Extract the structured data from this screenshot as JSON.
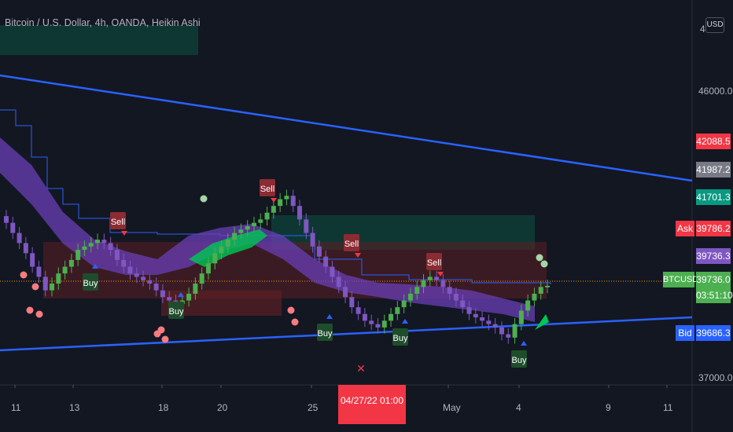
{
  "header": {
    "title": "Bitcoin / U.S. Dollar, 4h, OANDA, Heikin Ashi",
    "currency_button": "USD"
  },
  "price_axis": {
    "ticks": [
      "46000.0",
      "37000.0"
    ],
    "partial_top_tick": "4",
    "labels": {
      "ask_price": "42088.5",
      "last_close": "41987.2",
      "green_level": "41701.3",
      "ask_tag": "Ask",
      "ask_value": "39786.2",
      "purple_level": "39736.3",
      "symbol_tag": "BTCUSD",
      "current_price": "39736.0",
      "countdown": "03:51:10",
      "bid_tag": "Bid",
      "bid_value": "39686.3"
    }
  },
  "time_axis": {
    "ticks": [
      "11",
      "13",
      "18",
      "20",
      "25",
      "May",
      "4",
      "9",
      "11"
    ],
    "highlighted": "04/27/22  01:00"
  },
  "signals": {
    "buy_label": "Buy",
    "sell_label": "Sell",
    "cross_mark": "✕"
  },
  "colors": {
    "background": "#131722",
    "bull_candle": "#4caf50",
    "bear_candle": "#7e57c2",
    "trendline": "#2962ff",
    "sell_box": "#6d1a1f",
    "buy_box": "#1b5e20",
    "ask": "#f23645",
    "bid": "#2962ff",
    "last": "#4caf50"
  },
  "chart_data": {
    "type": "candlestick",
    "title": "Bitcoin / U.S. Dollar, 4h, OANDA, Heikin Ashi",
    "xlabel": "",
    "ylabel": "",
    "ylim": [
      36800,
      48200
    ],
    "x_ticks": [
      "11",
      "13",
      "18",
      "20",
      "25",
      "04/27/22  01:00",
      "May",
      "4",
      "9",
      "11"
    ],
    "y_ticks": [
      46000,
      37000
    ],
    "current_price": 39736.0,
    "ask": 39786.2,
    "bid": 39686.3,
    "candles_close_approx": [
      41600,
      41300,
      41000,
      40700,
      40300,
      40000,
      39600,
      39800,
      40100,
      40300,
      40500,
      40800,
      40900,
      41000,
      41100,
      41000,
      40800,
      40500,
      40300,
      40100,
      40000,
      39900,
      39800,
      39600,
      39400,
      39300,
      39200,
      39300,
      39500,
      39800,
      40100,
      40400,
      40700,
      40900,
      41100,
      41300,
      41400,
      41500,
      41600,
      41700,
      41900,
      42100,
      42300,
      42400,
      42100,
      41700,
      41300,
      40900,
      40600,
      40300,
      40000,
      39700,
      39400,
      39100,
      38900,
      38700,
      38600,
      38500,
      38700,
      38900,
      39100,
      39300,
      39500,
      39700,
      39900,
      40000,
      39900,
      39700,
      39500,
      39300,
      39100,
      38900,
      38800,
      38700,
      38600,
      38500,
      38300,
      38200,
      38600,
      39000,
      39300,
      39500,
      39700,
      39736
    ],
    "signals": [
      {
        "type": "sell",
        "x_label": "13"
      },
      {
        "type": "buy",
        "x_label": "13"
      },
      {
        "type": "buy",
        "x_label": "18"
      },
      {
        "type": "sell",
        "x_label": "20"
      },
      {
        "type": "sell",
        "x_label": "25"
      },
      {
        "type": "buy",
        "x_label": "25"
      },
      {
        "type": "buy",
        "x_label": "04/27/22  01:00"
      },
      {
        "type": "sell",
        "x_label": "May"
      },
      {
        "type": "buy",
        "x_label": "4"
      }
    ],
    "grid": false
  }
}
